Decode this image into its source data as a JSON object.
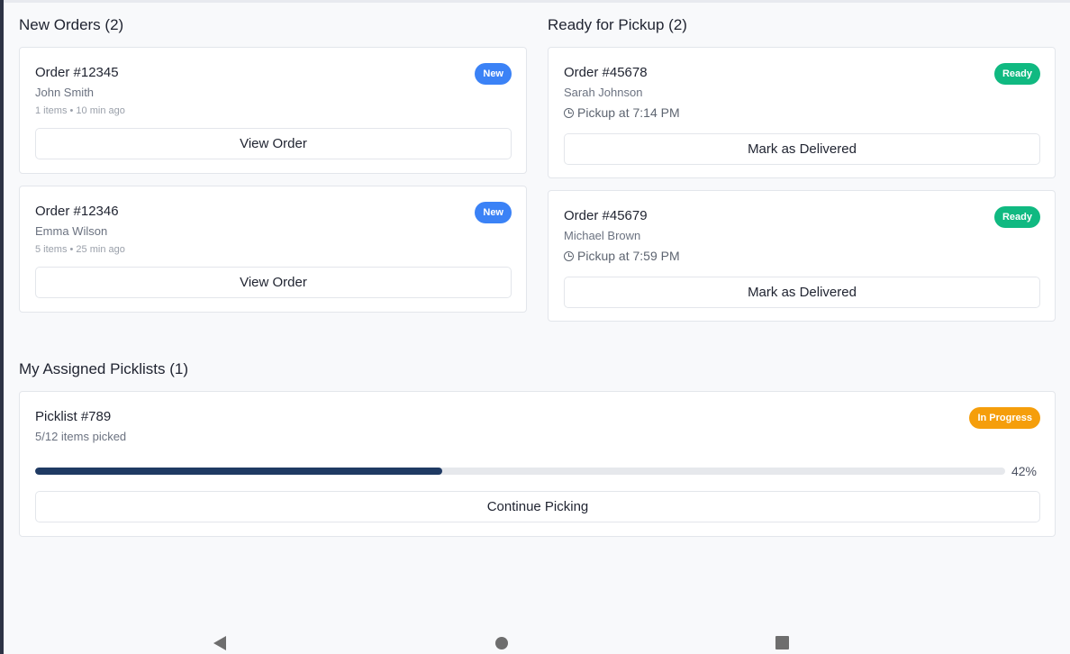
{
  "new_orders": {
    "title": "New Orders (2)",
    "orders": [
      {
        "title": "Order #12345",
        "customer": "John Smith",
        "meta": "1 items • 10 min ago",
        "badge": "New",
        "button": "View Order"
      },
      {
        "title": "Order #12346",
        "customer": "Emma Wilson",
        "meta": "5 items • 25 min ago",
        "badge": "New",
        "button": "View Order"
      }
    ]
  },
  "ready_for_pickup": {
    "title": "Ready for Pickup (2)",
    "orders": [
      {
        "title": "Order #45678",
        "customer": "Sarah Johnson",
        "pickup": "Pickup at 7:14 PM",
        "badge": "Ready",
        "button": "Mark as Delivered"
      },
      {
        "title": "Order #45679",
        "customer": "Michael Brown",
        "pickup": "Pickup at 7:59 PM",
        "badge": "Ready",
        "button": "Mark as Delivered"
      }
    ]
  },
  "picklists": {
    "title": "My Assigned Picklists (1)",
    "items": [
      {
        "title": "Picklist #789",
        "progress_text": "5/12 items picked",
        "badge": "In Progress",
        "percent": "42%",
        "progress": 0.42,
        "button": "Continue Picking"
      }
    ]
  },
  "colors": {
    "new_badge": "#3b82f6",
    "ready_badge": "#10b981",
    "in_progress_badge": "#f59e0b",
    "progress_fill": "#1f3a63"
  },
  "nav": {
    "back": "back-icon",
    "home": "home-icon",
    "recents": "recents-icon"
  }
}
